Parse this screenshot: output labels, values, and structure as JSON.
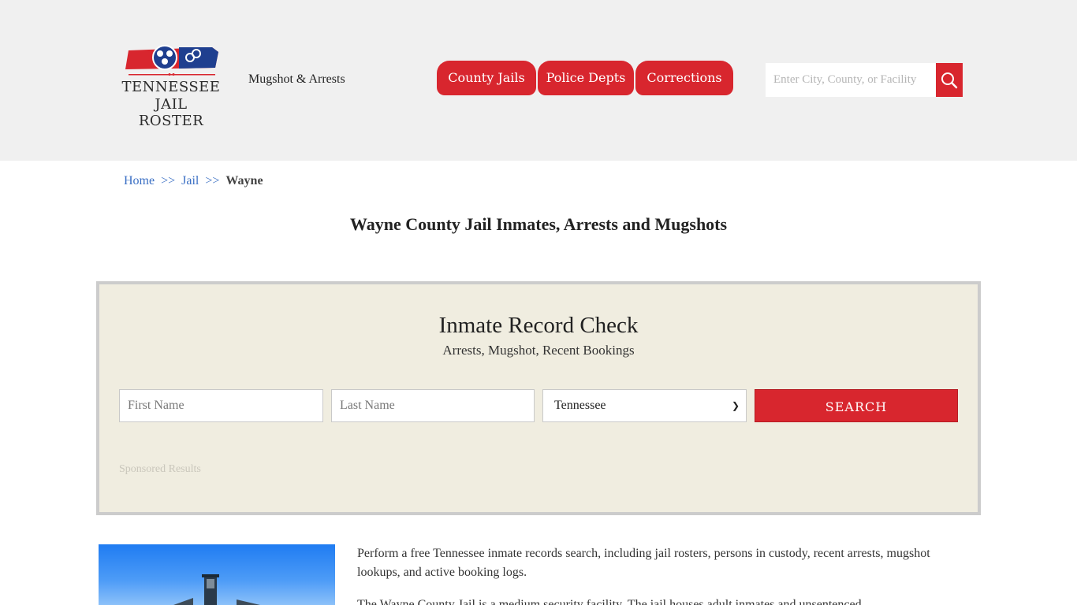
{
  "header": {
    "logo": {
      "line1": "TENNESSEE",
      "line2": "JAIL ROSTER",
      "colors": {
        "red": "#d8262e",
        "blue": "#1f3f8f"
      }
    },
    "tagline": "Mugshot & Arrests",
    "nav": [
      {
        "label": "County Jails"
      },
      {
        "label": "Police Depts"
      },
      {
        "label": "Corrections"
      }
    ],
    "search": {
      "placeholder": "Enter City, County, or Facility",
      "icon": "search-icon"
    }
  },
  "breadcrumb": {
    "items": [
      "Home",
      "Jail"
    ],
    "separator": ">>",
    "current": "Wayne"
  },
  "page_title": "Wayne County Jail Inmates, Arrests and Mugshots",
  "record_check": {
    "title": "Inmate Record Check",
    "subtitle": "Arrests, Mugshot, Recent Bookings",
    "first_name_placeholder": "First Name",
    "last_name_placeholder": "Last Name",
    "state_selected": "Tennessee",
    "search_label": "SEARCH",
    "sponsored": "Sponsored Results"
  },
  "content": {
    "intro": "Perform a free Tennessee inmate records search, including jail rosters, persons in custody, recent arrests, mugshot lookups, and active booking logs.",
    "intro2": "The Wayne County Jail is a medium security facility. The jail houses adult inmates and unsentenced"
  },
  "colors": {
    "accent": "#d8262e",
    "header_bg": "#f0f0f0",
    "box_bg": "#f0ede0",
    "link": "#3a6fc4"
  }
}
